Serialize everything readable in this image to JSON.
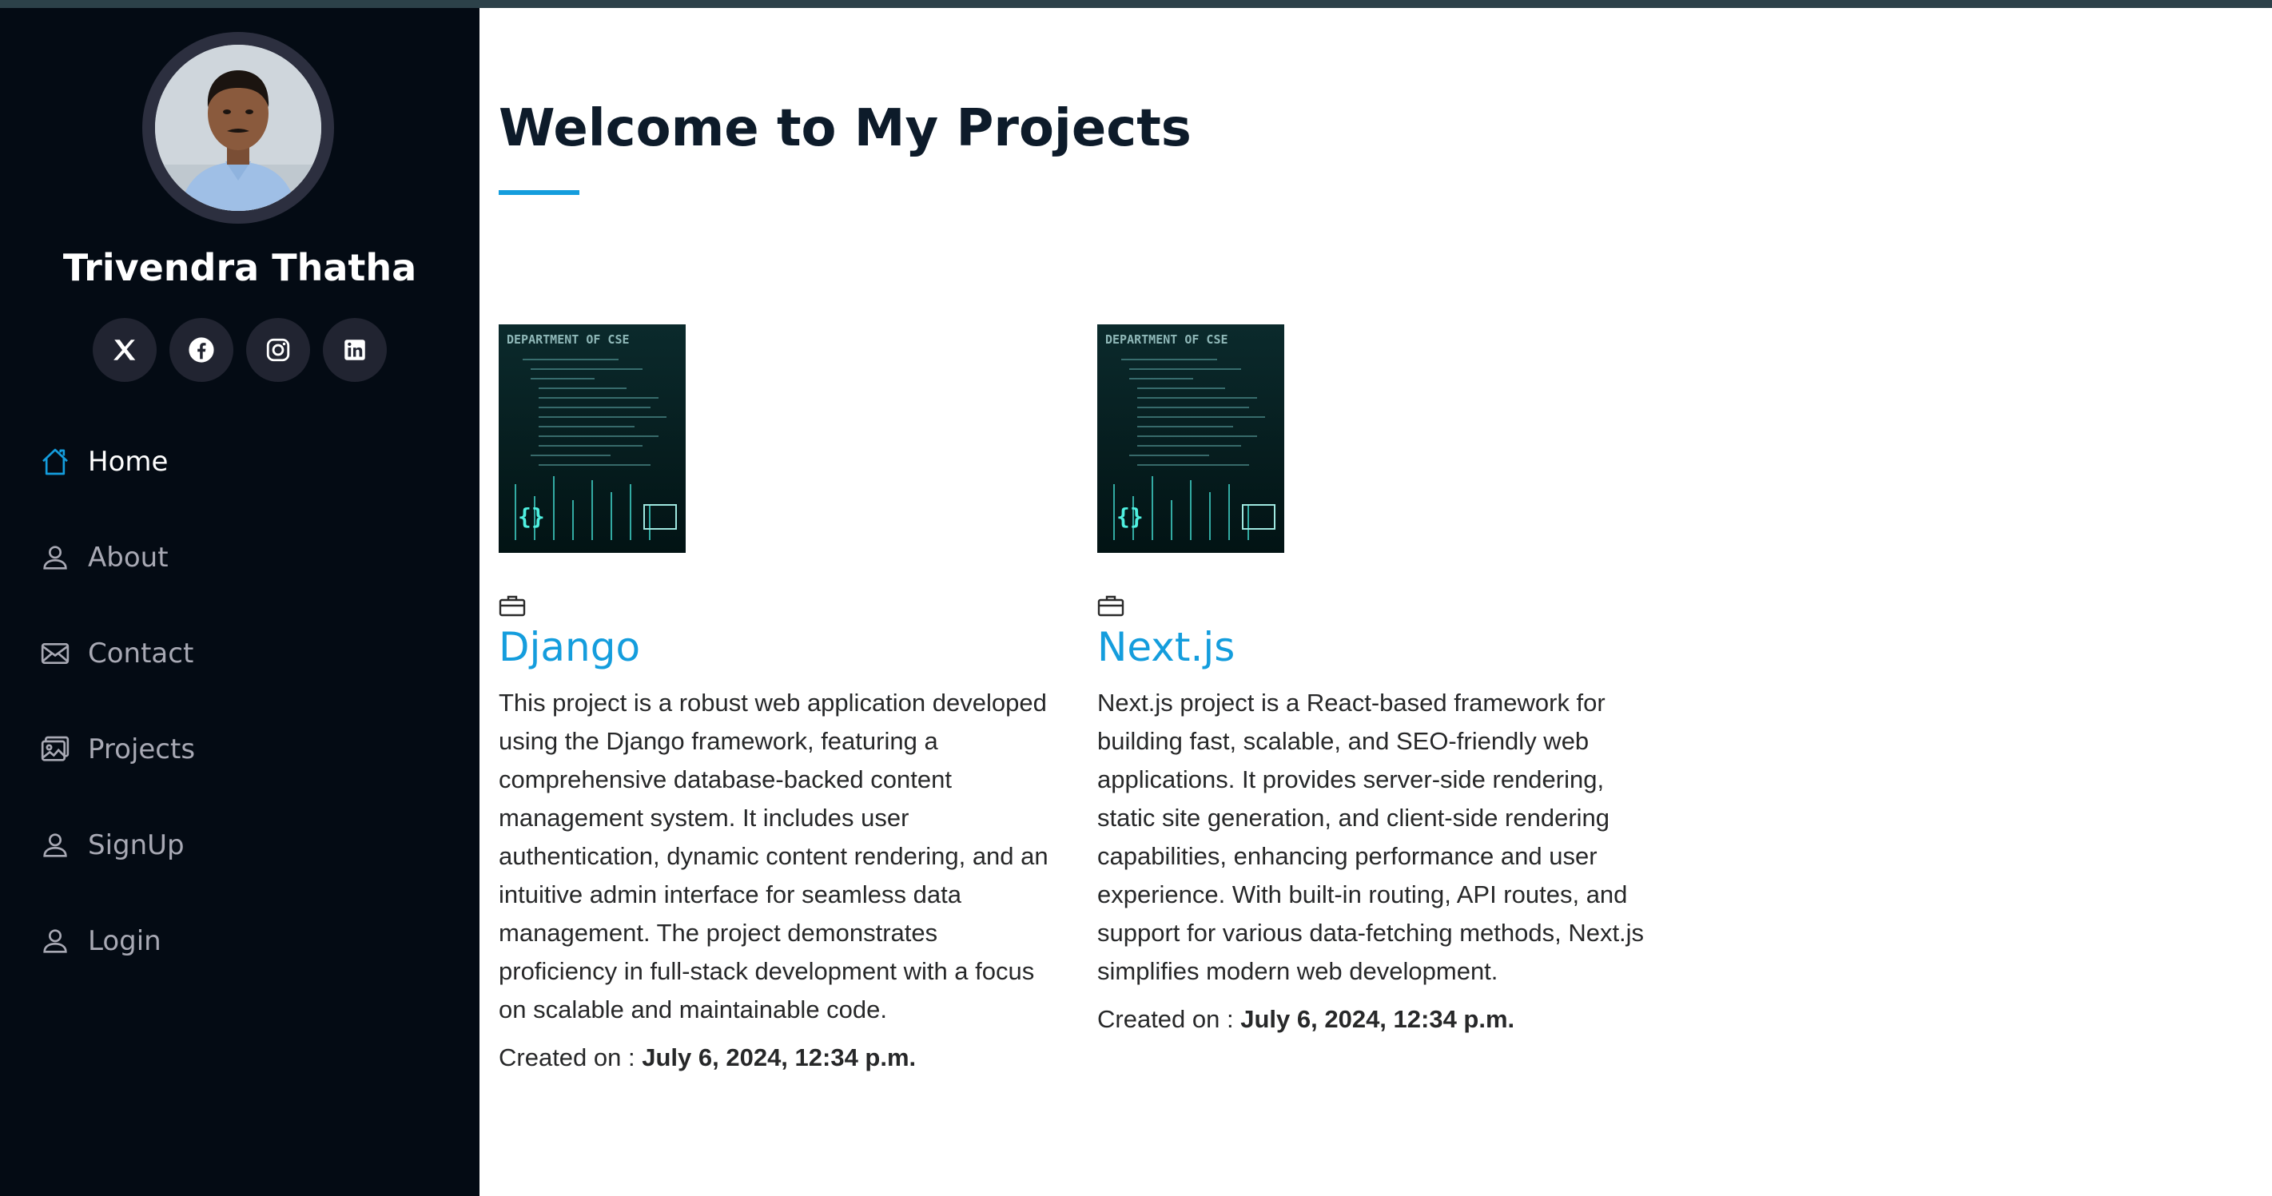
{
  "profile": {
    "name": "Trivendra Thatha"
  },
  "social": [
    {
      "icon": "x-twitter-icon"
    },
    {
      "icon": "facebook-icon"
    },
    {
      "icon": "instagram-icon"
    },
    {
      "icon": "linkedin-icon"
    }
  ],
  "nav": {
    "items": [
      {
        "label": "Home",
        "icon": "house-icon",
        "active": true
      },
      {
        "label": "About",
        "icon": "person-icon"
      },
      {
        "label": "Contact",
        "icon": "envelope-icon"
      },
      {
        "label": "Projects",
        "icon": "images-icon"
      },
      {
        "label": "SignUp",
        "icon": "person-icon"
      },
      {
        "label": "Login",
        "icon": "person-icon"
      }
    ]
  },
  "main": {
    "title": "Welcome to My Projects",
    "projects": [
      {
        "title": "Django",
        "description": "This project is a robust web application developed using the Django framework, featuring a comprehensive database-backed content management system. It includes user authentication, dynamic content rendering, and an intuitive admin interface for seamless data management. The project demonstrates proficiency in full-stack development with a focus on scalable and maintainable code.",
        "created_label": "Created on :",
        "created_value": "July 6, 2024, 12:34 p.m.",
        "thumb_caption": "DEPARTMENT OF CSE"
      },
      {
        "title": "Next.js",
        "description": "Next.js project is a React-based framework for building fast, scalable, and SEO-friendly web applications. It provides server-side rendering, static site generation, and client-side rendering capabilities, enhancing performance and user experience. With built-in routing, API routes, and support for various data-fetching methods, Next.js simplifies modern web development.",
        "created_label": "Created on :",
        "created_value": "July 6, 2024, 12:34 p.m.",
        "thumb_caption": "DEPARTMENT OF CSE"
      }
    ]
  },
  "colors": {
    "sidebar_bg": "#040b14",
    "accent": "#149ddd",
    "social_bg": "#212431",
    "nav_text": "#a8a9b4"
  }
}
